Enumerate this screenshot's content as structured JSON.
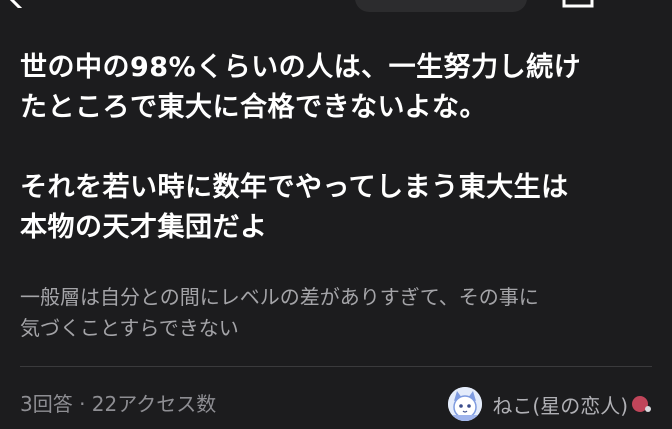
{
  "header": {
    "back_icon": "chevron-left-icon",
    "share_icon": "share-icon"
  },
  "question": {
    "title": "世の中の98%くらいの人は、一生努力し続け\nたところで東大に合格できないよな。\n\nそれを若い時に数年でやってしまう東大生は\n本物の天才集団だよ",
    "body": "一般層は自分との間にレベルの差がありすぎて、その事に\n気づくことすらできない"
  },
  "meta": {
    "stats": "3回答 · 22アクセス数"
  },
  "author": {
    "name": "ねこ(星の恋人)",
    "avatar_icon": "cat-avatar-icon",
    "badge_icon": "red-badge-icon"
  },
  "colors": {
    "background": "#1c1c1e",
    "title": "#ffffff",
    "body": "#a4a4a8",
    "meta": "#8e8e93",
    "badge": "#c0455a"
  }
}
